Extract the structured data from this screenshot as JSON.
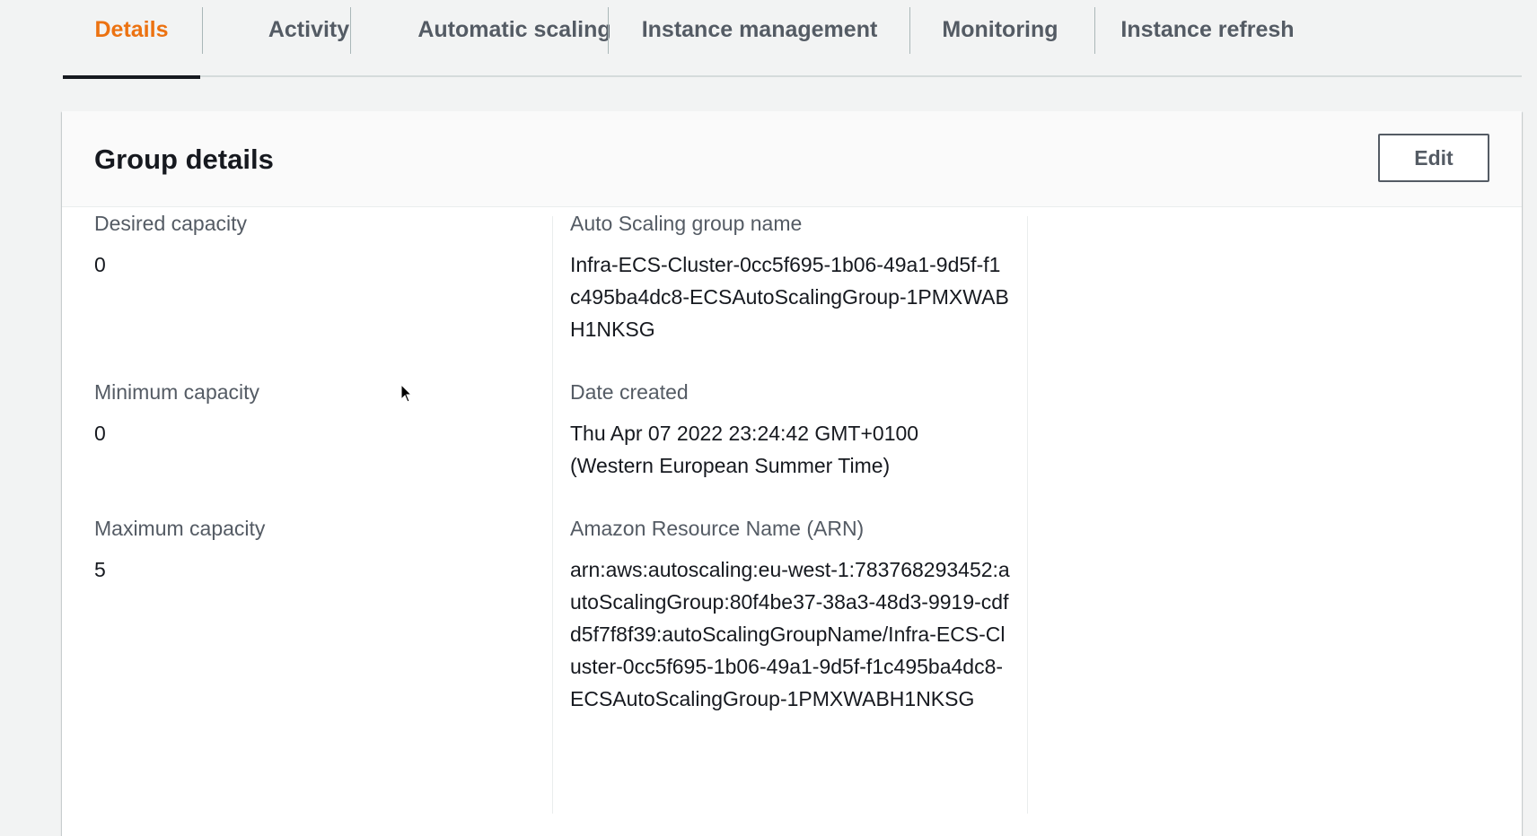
{
  "tabs": [
    {
      "label": "Details",
      "active": true
    },
    {
      "label": "Activity",
      "active": false
    },
    {
      "label": "Automatic scaling",
      "active": false
    },
    {
      "label": "Instance management",
      "active": false
    },
    {
      "label": "Monitoring",
      "active": false
    },
    {
      "label": "Instance refresh",
      "active": false
    }
  ],
  "group_details": {
    "title": "Group details",
    "edit_label": "Edit",
    "desired_capacity": {
      "label": "Desired capacity",
      "value": "0"
    },
    "minimum_capacity": {
      "label": "Minimum capacity",
      "value": "0"
    },
    "maximum_capacity": {
      "label": "Maximum capacity",
      "value": "5"
    },
    "group_name": {
      "label": "Auto Scaling group name",
      "value": "Infra-ECS-Cluster-0cc5f695-1b06-49a1-9d5f-f1c495ba4dc8-ECSAutoScalingGroup-1PMXWABH1NKSG"
    },
    "date_created": {
      "label": "Date created",
      "value": "Thu Apr 07 2022 23:24:42 GMT+0100 (Western European Summer Time)"
    },
    "arn": {
      "label": "Amazon Resource Name (ARN)",
      "value": "arn:aws:autoscaling:eu-west-1:783768293452:autoScalingGroup:80f4be37-38a3-48d3-9919-cdfd5f7f8f39:autoScalingGroupName/Infra-ECS-Cluster-0cc5f695-1b06-49a1-9d5f-f1c495ba4dc8-ECSAutoScalingGroup-1PMXWABH1NKSG"
    }
  },
  "colors": {
    "active_tab": "#ec7211",
    "tab_text": "#545b64",
    "page_background": "#f2f3f3"
  }
}
